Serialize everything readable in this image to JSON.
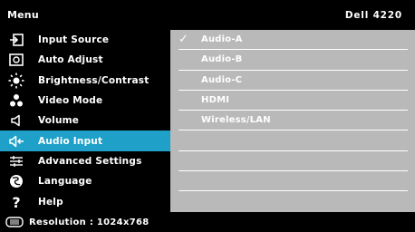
{
  "header": {
    "title": "Menu",
    "model": "Dell 4220"
  },
  "menu": [
    {
      "label": "Input Source",
      "icon": "input-source-icon"
    },
    {
      "label": "Auto Adjust",
      "icon": "auto-adjust-icon"
    },
    {
      "label": "Brightness/Contrast",
      "icon": "brightness-icon"
    },
    {
      "label": "Video Mode",
      "icon": "video-mode-icon"
    },
    {
      "label": "Volume",
      "icon": "volume-icon"
    },
    {
      "label": "Audio Input",
      "icon": "audio-input-icon",
      "selected": true
    },
    {
      "label": "Advanced Settings",
      "icon": "advanced-settings-icon"
    },
    {
      "label": "Language",
      "icon": "language-icon"
    },
    {
      "label": "Help",
      "icon": "help-icon"
    }
  ],
  "options": [
    {
      "label": "Audio-A",
      "checked": true
    },
    {
      "label": "Audio-B"
    },
    {
      "label": "Audio-C"
    },
    {
      "label": "HDMI"
    },
    {
      "label": "Wireless/LAN"
    },
    {
      "label": ""
    },
    {
      "label": ""
    },
    {
      "label": ""
    },
    {
      "label": ""
    }
  ],
  "check_mark": "✓",
  "footer": {
    "text": "Resolution : 1024x768",
    "icon": "display-icon"
  },
  "colors": {
    "background": "#000000",
    "selected": "#1fa0c8",
    "options_panel": "#b9b9b9"
  }
}
